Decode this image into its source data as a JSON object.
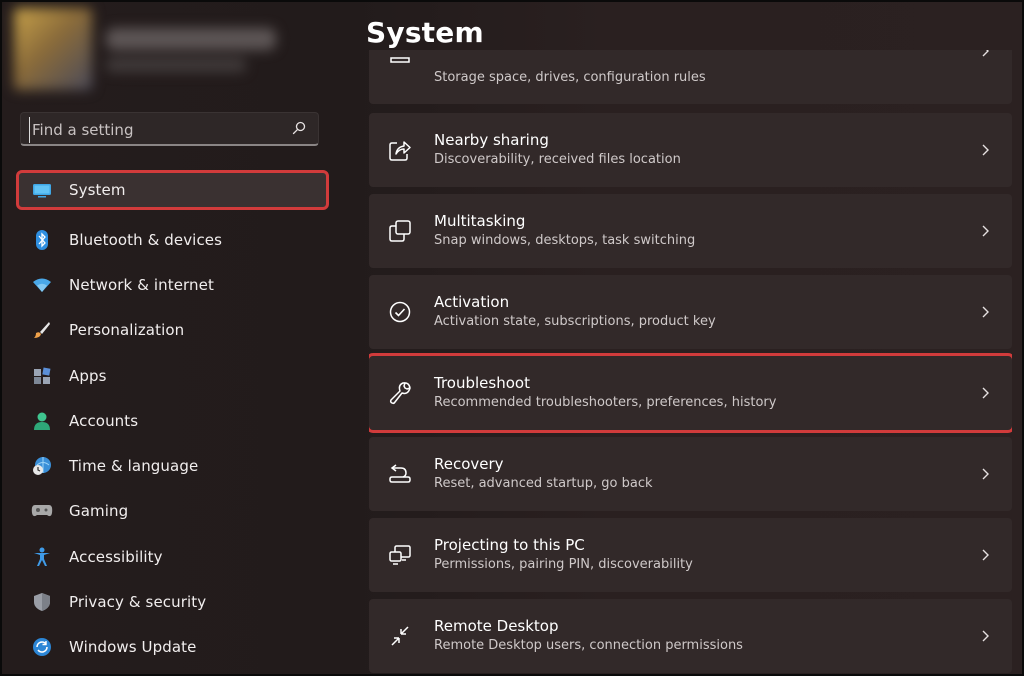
{
  "sidebar": {
    "search": {
      "placeholder": "Find a setting"
    },
    "items": [
      {
        "label": "System",
        "icon": "system-monitor-icon",
        "active": true
      },
      {
        "label": "Bluetooth & devices",
        "icon": "bluetooth-icon"
      },
      {
        "label": "Network & internet",
        "icon": "wifi-icon"
      },
      {
        "label": "Personalization",
        "icon": "brush-icon"
      },
      {
        "label": "Apps",
        "icon": "apps-icon"
      },
      {
        "label": "Accounts",
        "icon": "accounts-icon"
      },
      {
        "label": "Time & language",
        "icon": "globe-clock-icon"
      },
      {
        "label": "Gaming",
        "icon": "gamepad-icon"
      },
      {
        "label": "Accessibility",
        "icon": "accessibility-icon"
      },
      {
        "label": "Privacy & security",
        "icon": "shield-icon"
      },
      {
        "label": "Windows Update",
        "icon": "update-icon"
      }
    ]
  },
  "main": {
    "title": "System",
    "cards": [
      {
        "title": "",
        "subtitle": "Storage space, drives, configuration rules",
        "icon": "storage-icon"
      },
      {
        "title": "Nearby sharing",
        "subtitle": "Discoverability, received files location",
        "icon": "share-icon"
      },
      {
        "title": "Multitasking",
        "subtitle": "Snap windows, desktops, task switching",
        "icon": "multitasking-icon"
      },
      {
        "title": "Activation",
        "subtitle": "Activation state, subscriptions, product key",
        "icon": "activation-check-icon"
      },
      {
        "title": "Troubleshoot",
        "subtitle": "Recommended troubleshooters, preferences, history",
        "icon": "wrench-icon",
        "highlighted": true
      },
      {
        "title": "Recovery",
        "subtitle": "Reset, advanced startup, go back",
        "icon": "recovery-icon"
      },
      {
        "title": "Projecting to this PC",
        "subtitle": "Permissions, pairing PIN, discoverability",
        "icon": "projecting-icon"
      },
      {
        "title": "Remote Desktop",
        "subtitle": "Remote Desktop users, connection permissions",
        "icon": "remote-desktop-icon"
      }
    ]
  },
  "colors": {
    "highlight": "#d13b3b",
    "card": "#322929",
    "background": "#241c1c"
  }
}
